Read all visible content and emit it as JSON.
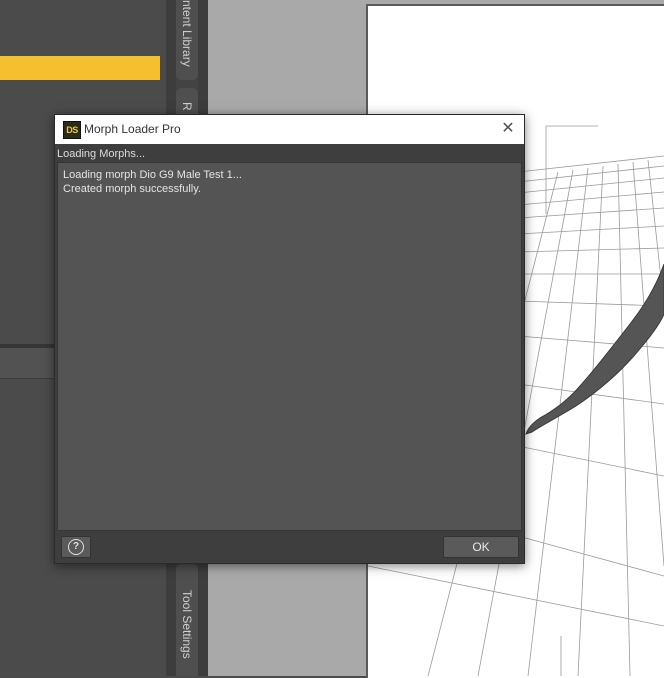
{
  "side_tabs": {
    "content_library": "ntent Library",
    "render": "R",
    "tool_settings": "Tool Settings"
  },
  "dialog": {
    "title": "Morph Loader Pro",
    "app_icon_text": "DS",
    "close_symbol": "✕",
    "status": "Loading Morphs...",
    "log_lines": [
      "Loading morph Dio G9 Male Test 1...",
      "Created morph successfully."
    ],
    "help_symbol": "?",
    "ok_label": "OK"
  },
  "colors": {
    "accent_yellow": "#f5bf2f",
    "panel_bg": "#4b4b4b",
    "dialog_log_bg": "#545454"
  }
}
